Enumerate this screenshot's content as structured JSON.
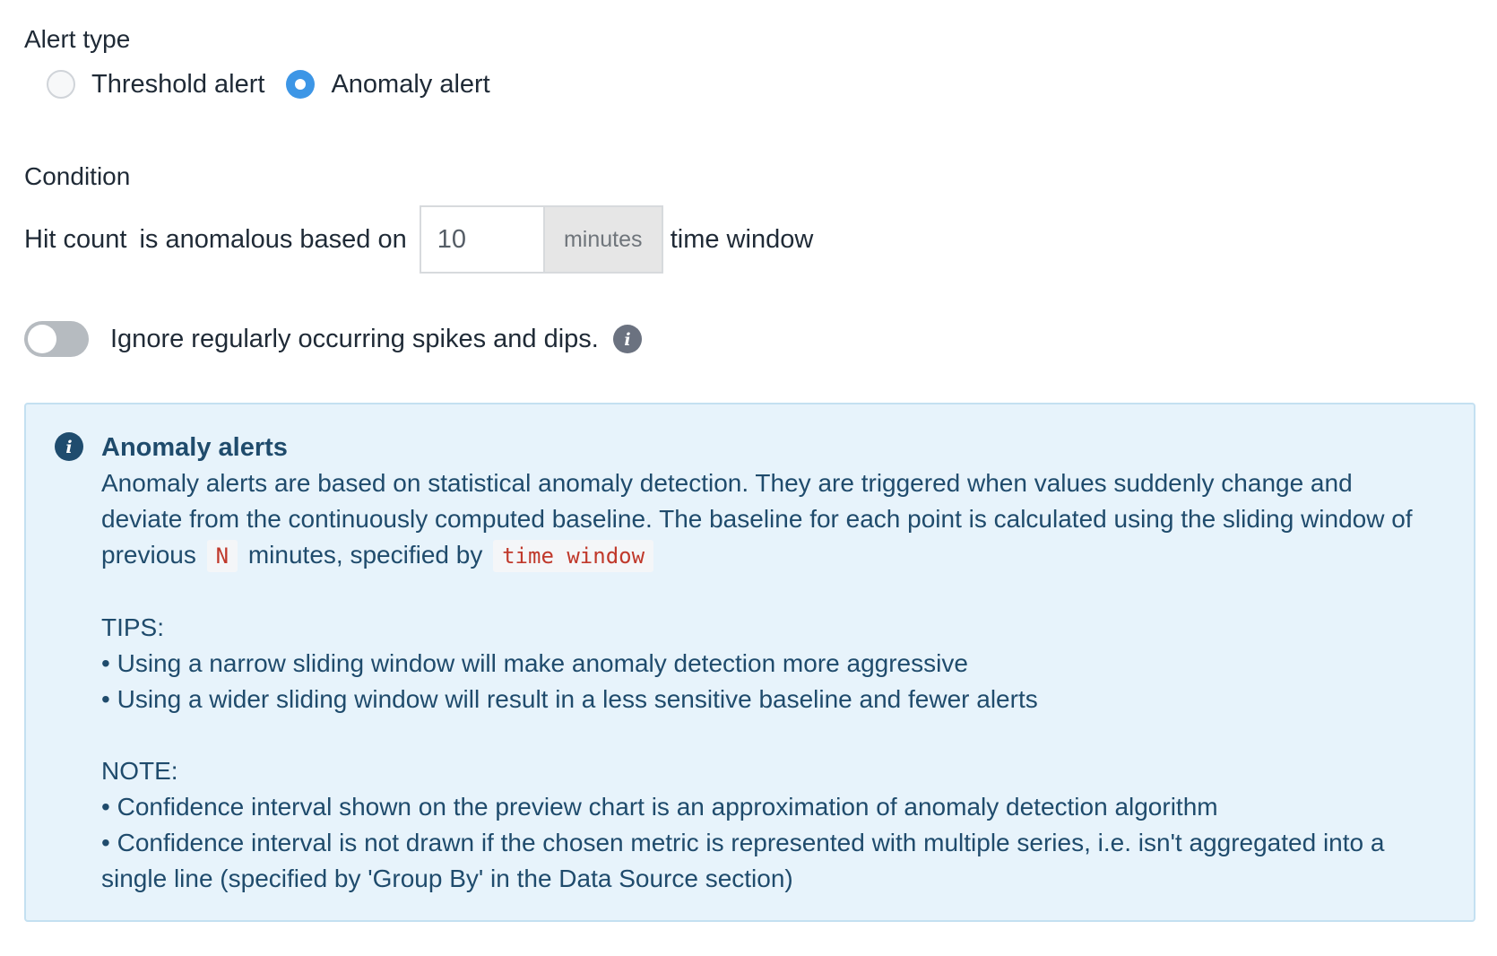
{
  "alert_type": {
    "label": "Alert type",
    "options": [
      {
        "label": "Threshold alert",
        "selected": false
      },
      {
        "label": "Anomaly alert",
        "selected": true
      }
    ]
  },
  "condition": {
    "label": "Condition",
    "metric": "Hit count",
    "text_before": "is anomalous based on",
    "input_value": "10",
    "unit": "minutes",
    "text_after": "time window"
  },
  "toggle": {
    "label": "Ignore regularly occurring spikes and dips.",
    "enabled": false
  },
  "info": {
    "title": "Anomaly alerts",
    "description_1": "Anomaly alerts are based on statistical anomaly detection. They are triggered when values suddenly change and deviate from the continuously computed baseline. The baseline for each point is calculated using the sliding window of previous",
    "code_n": "N",
    "description_2": "minutes, specified by",
    "code_time_window": "time window",
    "tips_label": "TIPS:",
    "tips": [
      "Using a narrow sliding window will make anomaly detection more aggressive",
      "Using a wider sliding window will result in a less sensitive baseline and fewer alerts"
    ],
    "note_label": "NOTE:",
    "notes": [
      "Confidence interval shown on the preview chart is an approximation of anomaly detection algorithm",
      "Confidence interval is not drawn if the chosen metric is represented with multiple series, i.e. isn't aggregated into a single line (specified by 'Group By' in the Data Source section)"
    ]
  },
  "colors": {
    "accent": "#3d96e6",
    "info_bg": "#e7f3fb",
    "info_text": "#1f4b6c",
    "code_text": "#c0392b"
  }
}
